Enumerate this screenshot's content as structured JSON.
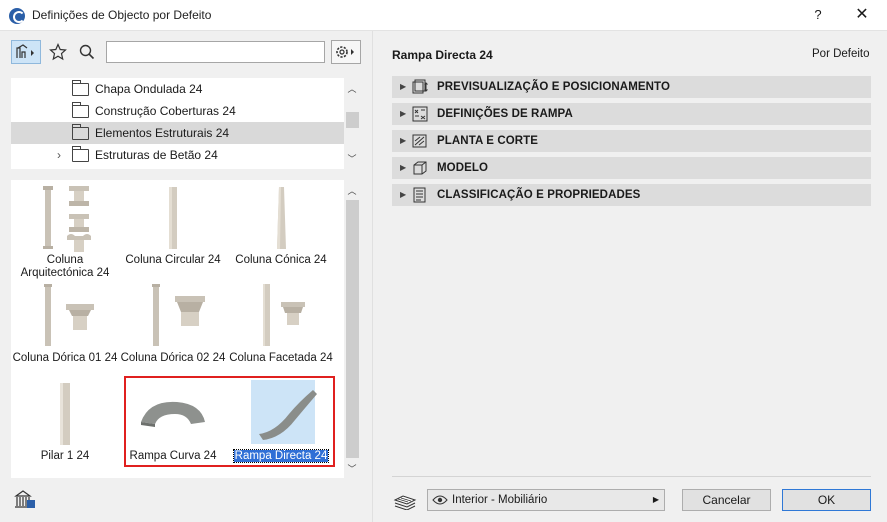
{
  "window": {
    "title": "Definições de Objecto por Defeito",
    "help_label": "?",
    "close_label": "✕"
  },
  "left": {
    "search": {
      "value": "",
      "placeholder": ""
    },
    "tree": [
      {
        "label": "Chapa Ondulada 24",
        "selected": false,
        "expandable": false
      },
      {
        "label": "Construção Coberturas 24",
        "selected": false,
        "expandable": false
      },
      {
        "label": "Elementos Estruturais 24",
        "selected": true,
        "expandable": false
      },
      {
        "label": "Estruturas de Betão 24",
        "selected": false,
        "expandable": true
      }
    ],
    "gallery": [
      {
        "label": "Coluna Arquitectónica 24",
        "icon": "column-architectonic"
      },
      {
        "label": "Coluna Circular 24",
        "icon": "column-circular"
      },
      {
        "label": "Coluna Cónica 24",
        "icon": "column-conic"
      },
      {
        "label": "Coluna Dórica 01 24",
        "icon": "column-doric"
      },
      {
        "label": "Coluna Dórica 02 24",
        "icon": "column-doric-2"
      },
      {
        "label": "Coluna Facetada 24",
        "icon": "column-faceted"
      },
      {
        "label": "Pilar 1 24",
        "icon": "pillar"
      },
      {
        "label": "Rampa Curva 24",
        "icon": "ramp-curved"
      },
      {
        "label": "Rampa Directa 24",
        "icon": "ramp-straight",
        "selected": true
      }
    ]
  },
  "right": {
    "object_name": "Rampa Directa 24",
    "default_label": "Por Defeito",
    "sections": [
      {
        "label": "PREVISUALIZAÇÃO E POSICIONAMENTO",
        "icon": "preview-icon"
      },
      {
        "label": "DEFINIÇÕES DE RAMPA",
        "icon": "ramp-settings-icon"
      },
      {
        "label": "PLANTA E CORTE",
        "icon": "floor-plan-icon"
      },
      {
        "label": "MODELO",
        "icon": "model-cube-icon"
      },
      {
        "label": "CLASSIFICAÇÃO E PROPRIEDADES",
        "icon": "classification-icon"
      }
    ]
  },
  "footer": {
    "layer_value": "Interior - Mobiliário",
    "cancel_label": "Cancelar",
    "ok_label": "OK"
  },
  "colors": {
    "selection_blue": "#2f6fd6",
    "highlight_red": "#e0201f",
    "section_bg": "#dcdcdc"
  }
}
